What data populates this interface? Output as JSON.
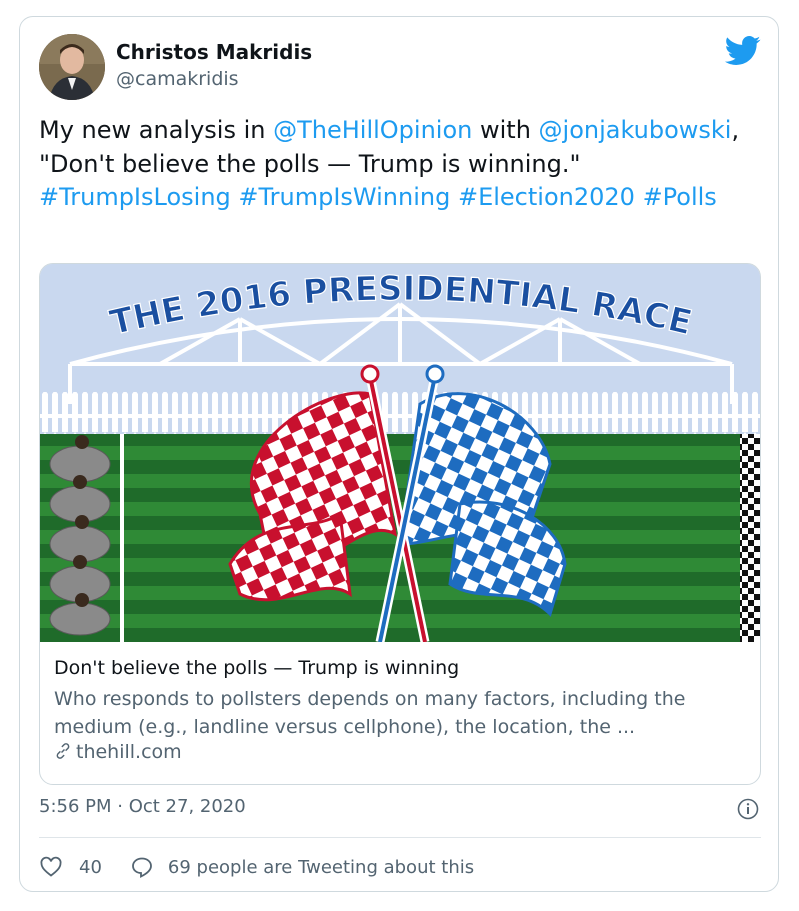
{
  "author": {
    "name": "Christos Makridis",
    "handle": "@camakridis"
  },
  "tweet": {
    "segments": [
      {
        "text": "My new analysis in ",
        "link": false
      },
      {
        "text": "@TheHillOpinion",
        "link": true
      },
      {
        "text": " with ",
        "link": false
      },
      {
        "text": "@jonjakubowski",
        "link": true
      },
      {
        "text": ", \"Don't believe the polls — Trump is winning.\" ",
        "link": false
      },
      {
        "text": "#TrumpIsLosing",
        "link": true
      },
      {
        "text": " ",
        "link": false
      },
      {
        "text": "#TrumpIsWinning",
        "link": true
      },
      {
        "text": " ",
        "link": false
      },
      {
        "text": "#Election2020",
        "link": true
      },
      {
        "text": " ",
        "link": false
      },
      {
        "text": "#Polls",
        "link": true
      }
    ]
  },
  "link_card": {
    "image_banner": "THE 2016 PRESIDENTIAL RACE",
    "title": "Don't believe the polls — Trump is winning",
    "description": "Who responds to pollsters depends on many factors, including the medium (e.g., landline versus cellphone), the location, the ...",
    "domain": "thehill.com"
  },
  "timestamp": "5:56 PM · Oct 27, 2020",
  "engagement": {
    "likes": "40",
    "replies_label": "69 people are Tweeting about this"
  },
  "colors": {
    "link": "#1d9bf0",
    "red_flag": "#c8102e",
    "blue_flag": "#1e6cc0",
    "grass_dark": "#1f6b2a",
    "grass_light": "#2f8a36"
  },
  "icons": {
    "brand": "twitter-bird-icon",
    "info": "info-icon",
    "like": "heart-icon",
    "reply": "speech-bubble-icon",
    "link": "chain-link-icon"
  }
}
